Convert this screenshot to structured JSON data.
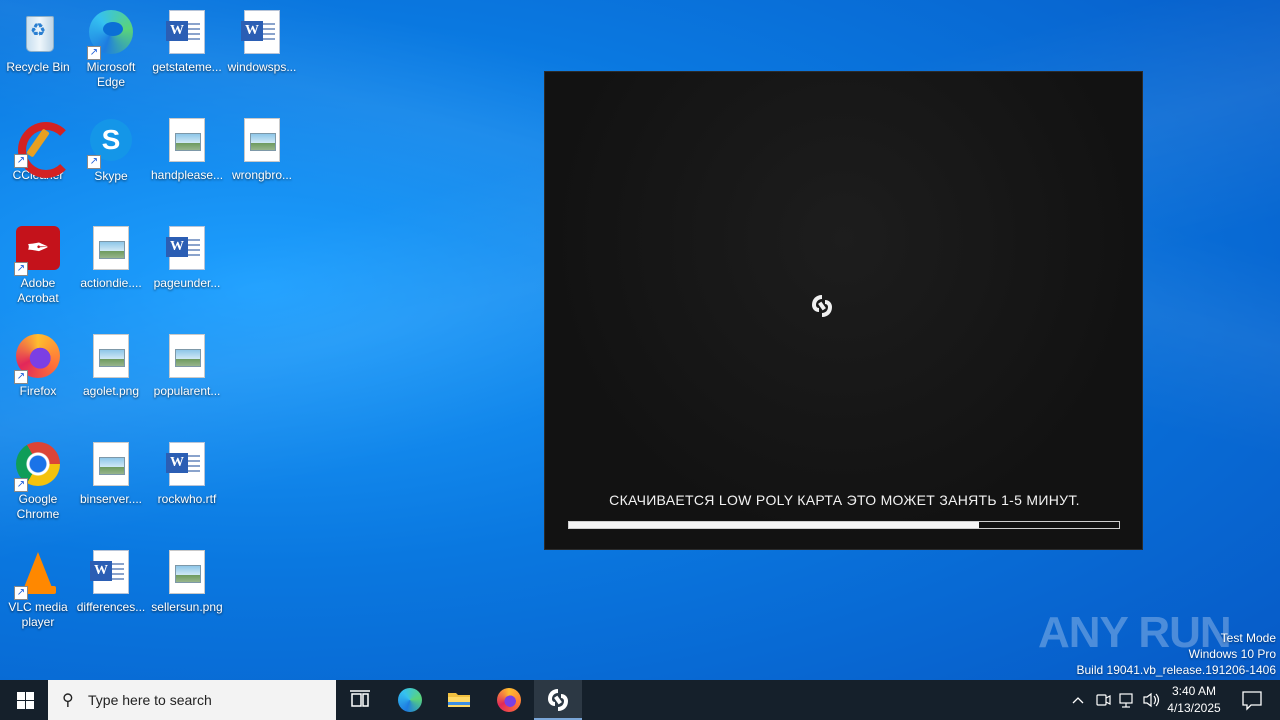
{
  "desktop": {
    "icons": [
      {
        "label": "Recycle Bin",
        "kind": "recycle-bin-icon"
      },
      {
        "label": "Microsoft Edge",
        "kind": "edge-icon"
      },
      {
        "label": "getstateme...",
        "kind": "word-document-icon"
      },
      {
        "label": "windowsps...",
        "kind": "word-document-icon"
      },
      {
        "label": "CCleaner",
        "kind": "ccleaner-icon"
      },
      {
        "label": "Skype",
        "kind": "skype-icon"
      },
      {
        "label": "handplease...",
        "kind": "image-file-icon"
      },
      {
        "label": "wrongbro...",
        "kind": "image-file-icon"
      },
      {
        "label": "Adobe Acrobat",
        "kind": "acrobat-icon"
      },
      {
        "label": "actiondie....",
        "kind": "image-file-icon"
      },
      {
        "label": "pageunder...",
        "kind": "word-document-icon"
      },
      {
        "label": "Firefox",
        "kind": "firefox-icon"
      },
      {
        "label": "agolet.png",
        "kind": "image-file-icon"
      },
      {
        "label": "popularent...",
        "kind": "image-file-icon"
      },
      {
        "label": "Google Chrome",
        "kind": "chrome-icon"
      },
      {
        "label": "binserver....",
        "kind": "image-file-icon"
      },
      {
        "label": "rockwho.rtf",
        "kind": "word-document-icon"
      },
      {
        "label": "VLC media player",
        "kind": "vlc-icon"
      },
      {
        "label": "differences...",
        "kind": "word-document-icon"
      },
      {
        "label": "sellersun.png",
        "kind": "image-file-icon"
      }
    ]
  },
  "loader": {
    "message": "СКАЧИВАЕТСЯ LOW POLY КАРТА ЭТО МОЖЕТ ЗАНЯТЬ 1-5 МИНУТ.",
    "progress": 0.745,
    "logo": "app-logo-icon"
  },
  "watermark": {
    "text": "ANY RUN"
  },
  "sysinfo": {
    "line1": "Test Mode",
    "line2": "Windows 10 Pro",
    "line3": "Build 19041.vb_release.191206-1406"
  },
  "taskbar": {
    "search_placeholder": "Type here to search",
    "time": "3:40 AM",
    "date": "4/13/2025",
    "apps": [
      "task-view-icon",
      "edge-icon",
      "file-explorer-icon",
      "firefox-icon",
      "app-logo-icon"
    ]
  },
  "colors": {
    "accent": "#0a78e0",
    "taskbar": "#15202b",
    "loader_bg": "#121212"
  }
}
